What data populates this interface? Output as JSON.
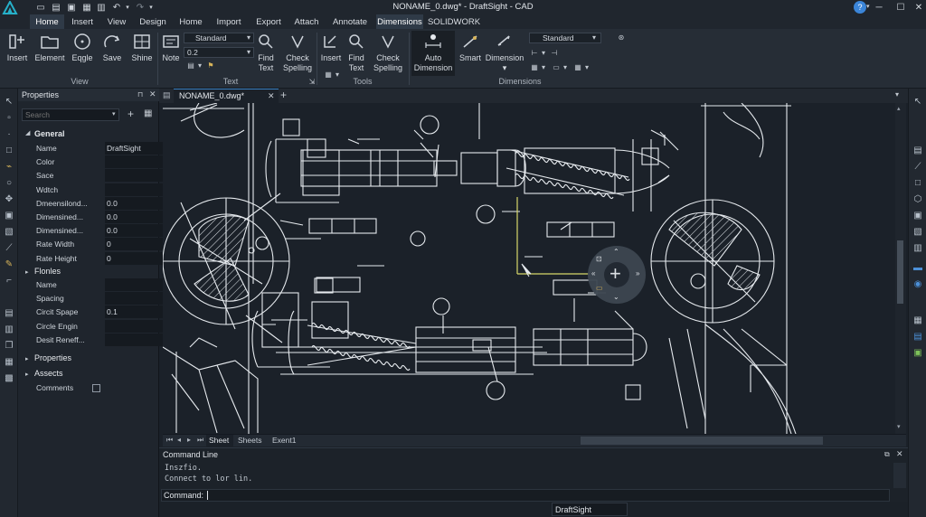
{
  "window": {
    "title": "NONAME_0.dwg* - DraftSight - CAD",
    "minimize_label": "─",
    "maximize_label": "☐",
    "close_label": "✕",
    "help_label": "?"
  },
  "menu_tabs": [
    "Home",
    "Insert",
    "View",
    "Design",
    "Home",
    "Import",
    "Export",
    "Attach",
    "Annotate",
    "Dimensions",
    "SOLIDWORK"
  ],
  "ribbon": {
    "buttons": {
      "insert": "Insert",
      "element": "Element",
      "eqgle": "Eqgle",
      "save": "Save",
      "shine": "Shine",
      "note": "Note",
      "find_text_1": "Find",
      "find_text_2": "Text",
      "check_spelling_1": "Check",
      "check_spelling_2": "Spelling",
      "insert2": "Insert",
      "find2_1": "Find",
      "find2_2": "Text",
      "check2_1": "Check",
      "check2_2": "Spelling",
      "auto_dim_1": "Auto",
      "auto_dim_2": "Dimension",
      "smart": "Smart",
      "dimension": "Dimension"
    },
    "text_style": "Standard",
    "text_height": "0.2",
    "dim_style": "Standard",
    "groups": {
      "view": "View",
      "text": "Text",
      "tools": "Tools",
      "dimensions": "Dimensions"
    }
  },
  "properties": {
    "title": "Properties",
    "search_placeholder": "Search",
    "sections": {
      "general": "General",
      "flonles": "Flonles",
      "properties": "Properties",
      "assects": "Assects"
    },
    "general_rows": [
      {
        "k": "Name",
        "v": "DraftSight"
      },
      {
        "k": "Color",
        "v": ""
      },
      {
        "k": "Sace",
        "v": ""
      },
      {
        "k": "Wdtch",
        "v": ""
      },
      {
        "k": "Dmeensilond...",
        "v": "0.0"
      },
      {
        "k": "Dimensined...",
        "v": "0.0"
      },
      {
        "k": "Dimensined...",
        "v": "0.0"
      },
      {
        "k": "Rate Width",
        "v": "0"
      },
      {
        "k": "Rate Height",
        "v": "0"
      }
    ],
    "flonles_rows": [
      {
        "k": "Name",
        "v": ""
      },
      {
        "k": "Spacing",
        "v": ""
      },
      {
        "k": "Circit Spape",
        "v": "0.1"
      },
      {
        "k": "Circle Engin",
        "v": ""
      },
      {
        "k": "Desit Reneff...",
        "v": ""
      }
    ],
    "comments_label": "Comments"
  },
  "doc_tab": "NONAME_0.dwg*",
  "sheet_tabs": [
    "Sheet",
    "Sheets",
    "Exent1"
  ],
  "command": {
    "title": "Command Line",
    "history": [
      "Inszfio.",
      "Connect to lor lin."
    ],
    "prompt": "Command:"
  },
  "status": {
    "app": "DraftSight"
  },
  "colors": {
    "accent": "#2f3a47",
    "bg": "#1b2129",
    "line": "#e8ecef",
    "highlight": "#d6d86a"
  }
}
